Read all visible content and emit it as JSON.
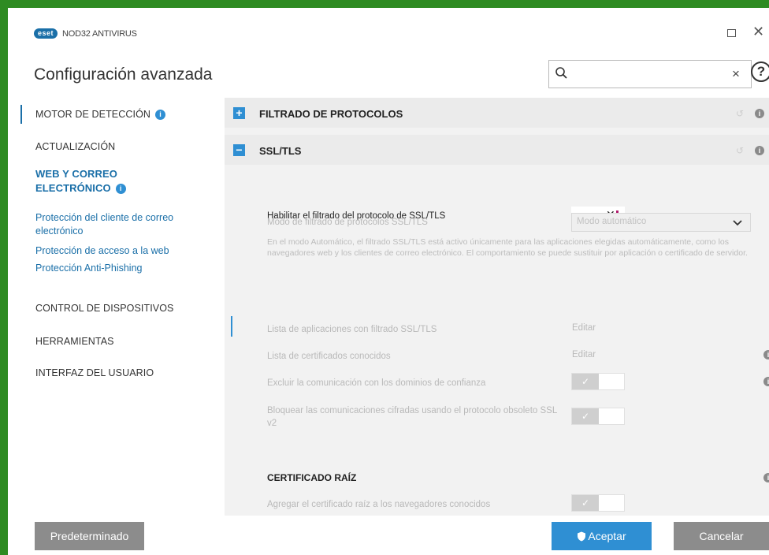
{
  "app": {
    "logo_text": "eset",
    "product_name": "NOD32 ANTIVIRUS",
    "page_title": "Configuración avanzada",
    "help_label": "?"
  },
  "search": {
    "value": "",
    "clear_label": "×"
  },
  "sidebar": {
    "items": [
      {
        "label": "MOTOR DE DETECCIÓN",
        "info": "i"
      },
      {
        "label": "ACTUALIZACIÓN"
      },
      {
        "label": "WEB Y CORREO ELECTRÓNICO",
        "info": "i",
        "active": true
      },
      {
        "label": "CONTROL DE DISPOSITIVOS"
      },
      {
        "label": "HERRAMIENTAS"
      },
      {
        "label": "INTERFAZ DEL USUARIO"
      }
    ],
    "subitems": [
      {
        "label": "Protección del cliente de correo electrónico"
      },
      {
        "label": "Protección de acceso a la web"
      },
      {
        "label": "Protección Anti-Phishing"
      }
    ]
  },
  "content": {
    "sections": [
      {
        "title": "FILTRADO DE PROTOCOLOS",
        "icon": "+",
        "expanded": false
      },
      {
        "title": "SSL/TLS",
        "icon": "−",
        "expanded": true
      }
    ],
    "ssl": {
      "enable_label": "Habilitar el filtrado del protocolo de SSL/TLS",
      "enable_state": false,
      "mode_label": "Modo de filtrado de protocolos SSL/TLS",
      "mode_value": "Modo automático",
      "description": "En el modo Automático, el filtrado SSL/TLS está activo únicamente para las aplicaciones elegidas automáticamente, como los navegadores web y los clientes de correo electrónico. El comportamiento se puede sustituir por aplicación o certificado de servidor.",
      "app_list_label": "Lista de aplicaciones con filtrado SSL/TLS",
      "app_list_link": "Editar",
      "cert_list_label": "Lista de certificados conocidos",
      "cert_list_link": "Editar",
      "exclude_label": "Excluir la comunicación con los dominios de confianza",
      "exclude_state": true,
      "block_label": "Bloquear las comunicaciones cifradas usando el protocolo obsoleto SSL v2",
      "block_state": true
    },
    "root_cert": {
      "title": "CERTIFICADO RAÍZ",
      "add_label": "Agregar el certificado raíz a los navegadores conocidos",
      "add_state": true
    },
    "info_label": "i",
    "undo_label": "↺",
    "check_label": "✓"
  },
  "footer": {
    "default_label": "Predeterminado",
    "accept_label": "Aceptar",
    "cancel_label": "Cancelar"
  },
  "colors": {
    "accent": "#2f8fd3",
    "link": "#1a6fa8",
    "gray_button": "#8c8c8c",
    "toggle_bar": "#b0186b"
  }
}
